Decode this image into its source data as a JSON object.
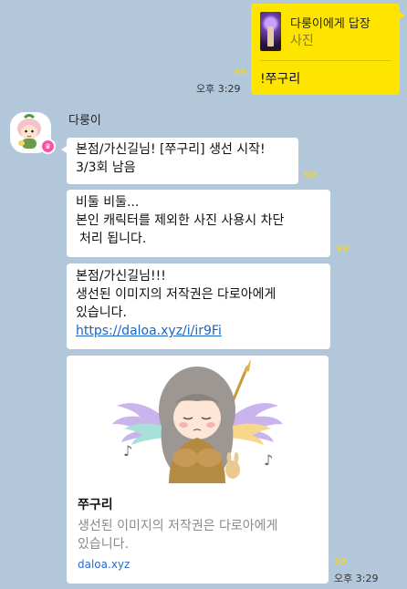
{
  "my_message": {
    "reply_to_label": "다룽이에게 답장",
    "reply_kind": "사진",
    "text": "!쭈구리",
    "unread_count": "99",
    "time": "오후 3:29"
  },
  "sender": {
    "name": "다룽이"
  },
  "messages": [
    {
      "lines": [
        "본점/가신길님! [쭈구리] 생선 시작!",
        "3/3회 남음"
      ],
      "unread_count": "99"
    },
    {
      "lines": [
        "비둘 비둘...",
        "본인 캐릭터를 제외한 사진 사용시 차단",
        "처리 됩니다."
      ],
      "unread_count": "99"
    },
    {
      "lines": [
        "본점/가신길님!!!",
        "생선된 이미지의 저작권은 다로아에게",
        "있습니다."
      ],
      "link": "https://daloa.xyz/i/ir9Fi"
    }
  ],
  "card": {
    "title": "쭈구리",
    "desc_lines": [
      "생선된 이미지의 저작권은 다로아에게",
      "있습니다."
    ],
    "domain": "daloa.xyz",
    "unread_count": "99",
    "time": "오후 3:29"
  }
}
